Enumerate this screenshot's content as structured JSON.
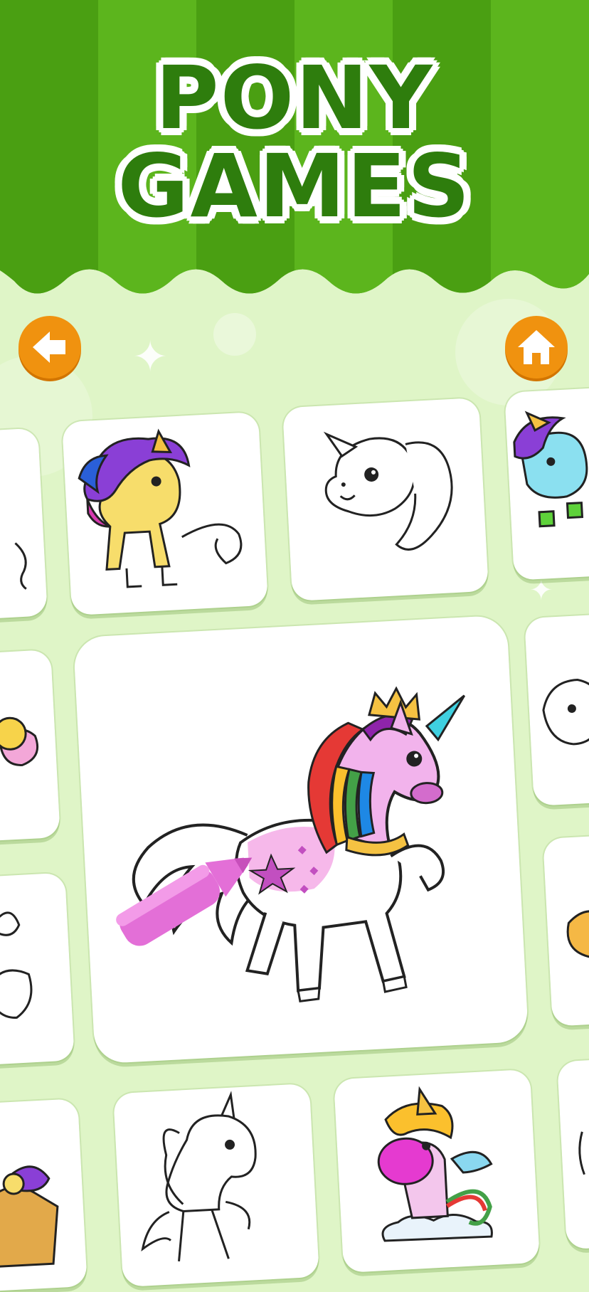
{
  "header": {
    "title_line1": "PONY",
    "title_line2": "GAMES",
    "awning_colors": [
      "#4da513",
      "#66bb22"
    ]
  },
  "nav": {
    "back_icon": "back-arrow-icon",
    "home_icon": "home-icon",
    "button_color": "#f0920f"
  },
  "featured": {
    "tool_icon": "crayon-icon",
    "crayon_color": "#e36fd7"
  },
  "pictures": [
    "unicorn-yellow-colored",
    "unicorn-head-outline",
    "unicorn-blue-flying",
    "unicorn-rainbow-featured",
    "unicorn-walking-outline",
    "unicorn-baby-rainbow-cloud"
  ]
}
